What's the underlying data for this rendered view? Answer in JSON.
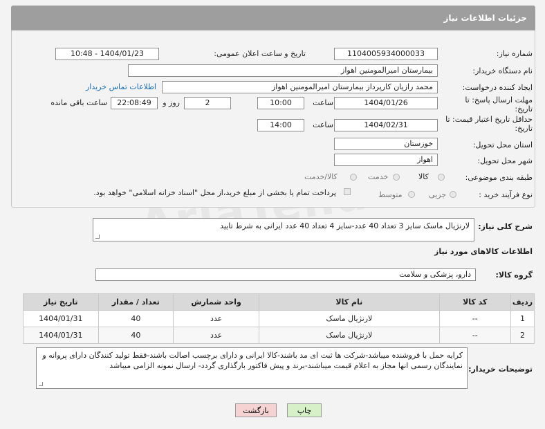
{
  "panel_title": "جزئیات اطلاعات نیاز",
  "labels": {
    "need_number": "شماره نیاز:",
    "announce_datetime": "تاریخ و ساعت اعلان عمومی:",
    "buyer_org": "نام دستگاه خریدار:",
    "requester": "ایجاد کننده درخواست:",
    "response_deadline": "مهلت ارسال پاسخ: تا تاریخ:",
    "price_validity": "حداقل تاریخ اعتبار قیمت: تا تاریخ:",
    "time": "ساعت",
    "time2": "ساعت",
    "day_and": "روز و",
    "hours_left": "ساعت باقی مانده",
    "province": "استان محل تحویل:",
    "city": "شهر محل تحویل:",
    "category": "طبقه بندی موضوعی:",
    "process_type": "نوع فرآیند خرید :",
    "description": "شرح کلی نیاز:",
    "goods_info": "اطلاعات کالاهای مورد نیاز",
    "goods_group": "گروه کالا:",
    "buyer_notes": "توضیحات خریدار:"
  },
  "values": {
    "need_number": "1104005934000033",
    "announce_datetime": "1404/01/23 - 10:48",
    "buyer_org": "بیمارستان امیرالمومنین اهواز",
    "requester": "محمد رازیان کارپرداز بیمارستان امیرالمومنین اهواز",
    "contact_link": "اطلاعات تماس خریدار",
    "response_date": "1404/01/26",
    "response_time": "10:00",
    "days_left": "2",
    "time_left": "22:08:49",
    "price_date": "1404/02/31",
    "price_time": "14:00",
    "province": "خوزستان",
    "city": "اهواز",
    "description": "لارنژیال ماسک سایز 3 تعداد 40 عدد-سایز 4 تعداد 40 عدد ایرانی به شرط تایید",
    "goods_group": "دارو، پزشکی و سلامت",
    "buyer_notes": "کرایه حمل با فروشنده میباشد-شرکت ها ثبت ای مد باشند-کالا ایرانی و دارای برچسب اصالت باشند-فقط تولید کنندگان دارای پروانه و نمایندگان رسمی انها مجاز به اعلام قیمت میباشند-برند و پیش فاکتور بارگذاری گردد- ارسال نمونه الزامی میباشد"
  },
  "category_options": [
    "کالا",
    "خدمت",
    "کالا/خدمت"
  ],
  "process_options": [
    "جزیی",
    "متوسط"
  ],
  "payment_note": "پرداخت تمام یا بخشی از مبلغ خرید،از محل \"اسناد خزانه اسلامی\" خواهد بود.",
  "table": {
    "headers": [
      "ردیف",
      "کد کالا",
      "نام کالا",
      "واحد شمارش",
      "تعداد / مقدار",
      "تاریخ نیاز"
    ],
    "rows": [
      [
        "1",
        "--",
        "لارنژیال ماسک",
        "عدد",
        "40",
        "1404/01/31"
      ],
      [
        "2",
        "--",
        "لارنژیال ماسک",
        "عدد",
        "40",
        "1404/01/31"
      ]
    ]
  },
  "buttons": {
    "print": "چاپ",
    "back": "بازگشت"
  },
  "watermark": "AriaTender.neT",
  "colors": {
    "header_bg": "#9e9e9e",
    "link": "#1a6fb8",
    "print_btn": "#d8f0c8",
    "back_btn": "#f6d3d3"
  }
}
